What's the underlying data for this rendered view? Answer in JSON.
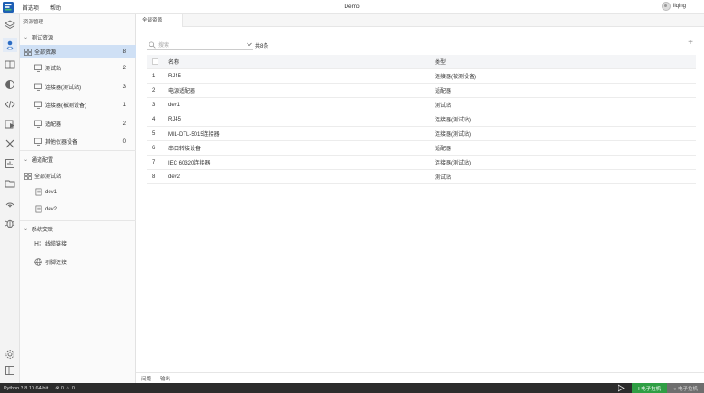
{
  "titlebar": {
    "menus": [
      "首选项",
      "帮助"
    ],
    "title": "Demo",
    "user": "liqing"
  },
  "sidebar": {
    "title": "资源管理",
    "sections": [
      {
        "label": "测试资源",
        "items": [
          {
            "label": "全部资源",
            "count": "8",
            "icon": "grid-icon",
            "selected": true
          },
          {
            "label": "测试站",
            "count": "2",
            "icon": "monitor-icon"
          },
          {
            "label": "连接器(测试站)",
            "count": "3",
            "icon": "monitor-icon"
          },
          {
            "label": "连接器(被测设备)",
            "count": "1",
            "icon": "monitor-icon"
          },
          {
            "label": "适配器",
            "count": "2",
            "icon": "monitor-icon"
          },
          {
            "label": "其他仪器设备",
            "count": "0",
            "icon": "monitor-icon"
          }
        ]
      },
      {
        "label": "通道配置",
        "items": [
          {
            "label": "全部测试站",
            "icon": "grid-icon"
          },
          {
            "label": "dev1",
            "icon": "document-icon"
          },
          {
            "label": "dev2",
            "icon": "document-icon"
          }
        ]
      },
      {
        "label": "系统交联",
        "items": [
          {
            "label": "线缆链接",
            "icon": "link-icon"
          },
          {
            "label": "引脚连接",
            "icon": "globe-icon"
          }
        ]
      }
    ]
  },
  "main": {
    "tab": "全部资源",
    "search_placeholder": "搜索",
    "total": "共8条",
    "add_label": "+",
    "columns": [
      "名称",
      "类型"
    ],
    "rows": [
      {
        "idx": "1",
        "name": "RJ45",
        "type": "连接器(被测设备)"
      },
      {
        "idx": "2",
        "name": "电源适配器",
        "type": "适配器"
      },
      {
        "idx": "3",
        "name": "dev1",
        "type": "测试站"
      },
      {
        "idx": "4",
        "name": "RJ45",
        "type": "连接器(测试站)"
      },
      {
        "idx": "5",
        "name": "MIL-DTL-5015连接器",
        "type": "连接器(测试站)"
      },
      {
        "idx": "6",
        "name": "串口转接设备",
        "type": "适配器"
      },
      {
        "idx": "7",
        "name": "IEC 60320连接器",
        "type": "连接器(测试站)"
      },
      {
        "idx": "8",
        "name": "dev2",
        "type": "测试站"
      }
    ]
  },
  "bottom_panel": {
    "tabs": [
      "问题",
      "输出"
    ]
  },
  "statusbar": {
    "python": "Python 3.8.10 64-bit",
    "errors": "0",
    "warnings": "0",
    "btn_online": "I 电子拉机",
    "btn_offline": "○ 电子拉机"
  },
  "colors": {
    "accent": "#2f9e44",
    "selection": "#cfe0f5",
    "statusbar": "#2c2c2c"
  }
}
